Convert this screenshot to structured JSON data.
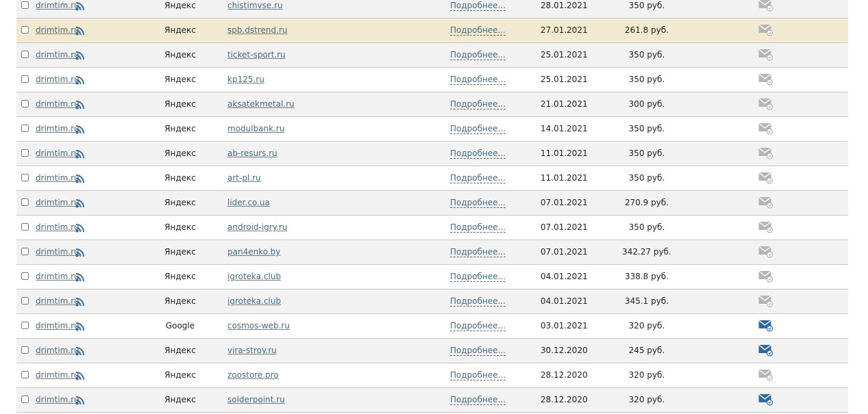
{
  "colors": {
    "link": "#3a6e90",
    "rss": "#3b6ea0",
    "mail_active": "#2e6ba0",
    "mail_inactive": "#b5b5b5",
    "row_highlight": "#f1ead1",
    "row_alt": "#f2f2f2"
  },
  "icons": {
    "rss": "rss-icon",
    "mail_active": "mail-sent-icon",
    "mail_inactive": "mail-icon"
  },
  "rows": [
    {
      "site": "drimtim.ru",
      "engine": "Яндекс",
      "domain": "chistimvse.ru",
      "more": "Подробнее...",
      "date": "28.01.2021",
      "price": "350 руб.",
      "mail": "inactive",
      "highlight": false
    },
    {
      "site": "drimtim.ru",
      "engine": "Яндекс",
      "domain": "spb.dstrend.ru",
      "more": "Подробнее...",
      "date": "27.01.2021",
      "price": "261.8 руб.",
      "mail": "inactive",
      "highlight": true
    },
    {
      "site": "drimtim.ru",
      "engine": "Яндекс",
      "domain": "ticket-sport.ru",
      "more": "Подробнее...",
      "date": "25.01.2021",
      "price": "350 руб.",
      "mail": "inactive",
      "highlight": false
    },
    {
      "site": "drimtim.ru",
      "engine": "Яндекс",
      "domain": "kp125.ru",
      "more": "Подробнее...",
      "date": "25.01.2021",
      "price": "350 руб.",
      "mail": "inactive",
      "highlight": false
    },
    {
      "site": "drimtim.ru",
      "engine": "Яндекс",
      "domain": "aksatekmetal.ru",
      "more": "Подробнее...",
      "date": "21.01.2021",
      "price": "300 руб.",
      "mail": "inactive",
      "highlight": false
    },
    {
      "site": "drimtim.ru",
      "engine": "Яндекс",
      "domain": "modulbank.ru",
      "more": "Подробнее...",
      "date": "14.01.2021",
      "price": "350 руб.",
      "mail": "inactive",
      "highlight": false
    },
    {
      "site": "drimtim.ru",
      "engine": "Яндекс",
      "domain": "ab-resurs.ru",
      "more": "Подробнее...",
      "date": "11.01.2021",
      "price": "350 руб.",
      "mail": "inactive",
      "highlight": false
    },
    {
      "site": "drimtim.ru",
      "engine": "Яндекс",
      "domain": "art-pl.ru",
      "more": "Подробнее...",
      "date": "11.01.2021",
      "price": "350 руб.",
      "mail": "inactive",
      "highlight": false
    },
    {
      "site": "drimtim.ru",
      "engine": "Яндекс",
      "domain": "lider.co.ua",
      "more": "Подробнее...",
      "date": "07.01.2021",
      "price": "270.9 руб.",
      "mail": "inactive",
      "highlight": false
    },
    {
      "site": "drimtim.ru",
      "engine": "Яндекс",
      "domain": "android-igry.ru",
      "more": "Подробнее...",
      "date": "07.01.2021",
      "price": "350 руб.",
      "mail": "inactive",
      "highlight": false
    },
    {
      "site": "drimtim.ru",
      "engine": "Яндекс",
      "domain": "pan4enko.by",
      "more": "Подробнее...",
      "date": "07.01.2021",
      "price": "342.27 руб.",
      "mail": "inactive",
      "highlight": false
    },
    {
      "site": "drimtim.ru",
      "engine": "Яндекс",
      "domain": "igroteka.club",
      "more": "Подробнее...",
      "date": "04.01.2021",
      "price": "338.8 руб.",
      "mail": "inactive",
      "highlight": false
    },
    {
      "site": "drimtim.ru",
      "engine": "Яндекс",
      "domain": "igroteka.club",
      "more": "Подробнее...",
      "date": "04.01.2021",
      "price": "345.1 руб.",
      "mail": "inactive",
      "highlight": false
    },
    {
      "site": "drimtim.ru",
      "engine": "Google",
      "domain": "cosmos-web.ru",
      "more": "Подробнее...",
      "date": "03.01.2021",
      "price": "320 руб.",
      "mail": "active",
      "highlight": false
    },
    {
      "site": "drimtim.ru",
      "engine": "Яндекс",
      "domain": "vira-stroy.ru",
      "more": "Подробнее...",
      "date": "30.12.2020",
      "price": "245 руб.",
      "mail": "active",
      "highlight": false
    },
    {
      "site": "drimtim.ru",
      "engine": "Яндекс",
      "domain": "zoostore.pro",
      "more": "Подробнее...",
      "date": "28.12.2020",
      "price": "320 руб.",
      "mail": "inactive",
      "highlight": false
    },
    {
      "site": "drimtim.ru",
      "engine": "Яндекс",
      "domain": "solderpoint.ru",
      "more": "Подробнее...",
      "date": "28.12.2020",
      "price": "320 руб.",
      "mail": "active",
      "highlight": false
    }
  ]
}
